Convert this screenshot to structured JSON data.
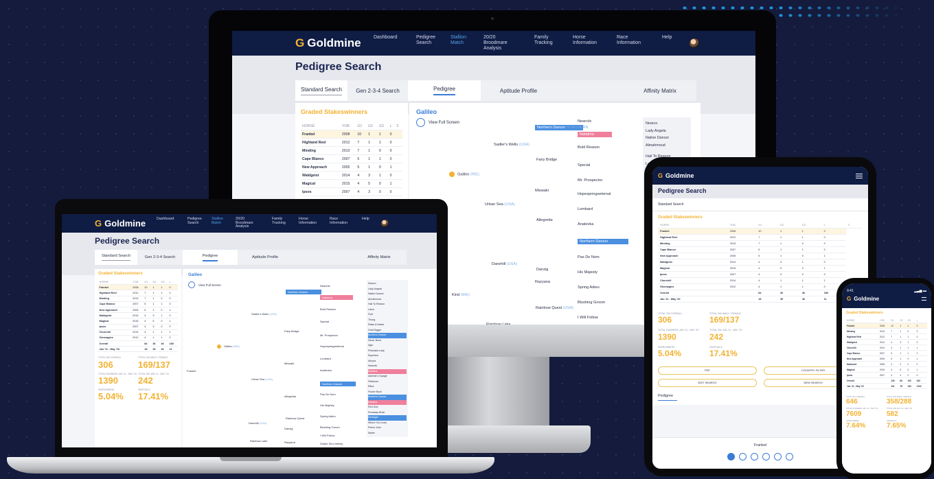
{
  "brand": {
    "logo_text": "Goldmine",
    "accent": "#f2b233",
    "nav_bg": "#0f1c44",
    "link_blue": "#3a7bd5"
  },
  "nav": {
    "items": [
      "Dashboard",
      "Pedigree Search",
      "Stallion Match",
      "20/20 Broodmare Analysis",
      "Family Tracking",
      "Horse Information",
      "Race Information",
      "Help"
    ],
    "active": "Stallion Match"
  },
  "page": {
    "title": "Pedigree Search"
  },
  "tabs": {
    "standard": "Standard Search",
    "gen": "Gen 2-3-4 Search",
    "pedigree": "Pedigree",
    "aptitude": "Aptitude Profile",
    "affinity": "Affinity Matrix"
  },
  "graded": {
    "title": "Graded Stakeswinners",
    "headers": [
      "HORSE",
      "YOB",
      "G1",
      "G2",
      "G3",
      "L",
      "Σ"
    ],
    "rows": [
      [
        "Frankel",
        "2008",
        "10",
        "1",
        "1",
        "0",
        ""
      ],
      [
        "Highland Reel",
        "2012",
        "7",
        "1",
        "1",
        "0",
        ""
      ],
      [
        "Minding",
        "2013",
        "7",
        "1",
        "0",
        "0",
        ""
      ],
      [
        "Cape Blanco",
        "2007",
        "5",
        "1",
        "1",
        "0",
        ""
      ],
      [
        "New Approach",
        "2005",
        "5",
        "1",
        "0",
        "1",
        ""
      ],
      [
        "Waldgeist",
        "2014",
        "4",
        "3",
        "1",
        "0",
        ""
      ],
      [
        "Magical",
        "2015",
        "4",
        "5",
        "0",
        "1",
        ""
      ],
      [
        "Ipsos",
        "2007",
        "4",
        "3",
        "0",
        "0",
        ""
      ],
      [
        "Churchill",
        "2014",
        "4",
        "1",
        "1",
        "1",
        ""
      ],
      [
        "Gleneagles",
        "2012",
        "4",
        "1",
        "1",
        "0",
        ""
      ]
    ],
    "laptop_rows": [
      [
        "Frankel",
        "2008",
        "10",
        "1",
        "1",
        "0"
      ],
      [
        "Highland Reel",
        "2012",
        "7",
        "1",
        "1",
        "0"
      ],
      [
        "Minding",
        "2013",
        "7",
        "1",
        "0",
        "0"
      ],
      [
        "Cape Blanco",
        "2007",
        "5",
        "1",
        "1",
        "0"
      ],
      [
        "New Approach",
        "2005",
        "5",
        "1",
        "0",
        "1"
      ],
      [
        "Waldgeist",
        "2014",
        "4",
        "3",
        "1",
        "0"
      ],
      [
        "Magical",
        "2015",
        "4",
        "5",
        "0",
        "1"
      ],
      [
        "Ipsos",
        "2007",
        "4",
        "3",
        "0",
        "0"
      ],
      [
        "Churchill",
        "2014",
        "4",
        "1",
        "1",
        "1"
      ],
      [
        "Gleneagles",
        "2012",
        "4",
        "1",
        "1",
        "0"
      ]
    ],
    "overall_label": "Overall",
    "overall": [
      "84",
      "36",
      "46",
      "180"
    ],
    "period_label": "Jan '11 - May '20",
    "period": [
      "18",
      "39",
      "46",
      "11"
    ]
  },
  "stats": {
    "winners_lbl": "TOTAL SW OVERALL",
    "winners_val": "306",
    "ratio_lbl": "TOTAL SW MALE / FEMALE",
    "ratio_val": "169/137",
    "runners_lbl": "TOTAL RUNNERS JAN '11 - MAY '20",
    "runners_val": "1390",
    "sw_lbl": "TOTAL SW JAN '11 - MAY '20",
    "sw_val": "242",
    "pct1_lbl": "SW/RUNNERS",
    "pct1_val": "5.04%",
    "pct2_lbl": "SW/FOALS",
    "pct2_val": "17.41%"
  },
  "pedigree": {
    "subject": "Galileo",
    "view_full": "View Full Screen",
    "sire": "Sadler's Wells",
    "sire_year": "(USA)",
    "dam": "Urban Sea",
    "dam_year": "(USA)",
    "fairy": "Fairy Bridge",
    "miswaki": "Miswaki",
    "allegretta": "Allegretta",
    "northern": "Northern Dancer",
    "northern_tag": "NORTHERN",
    "natalma": "Natalma",
    "bold": "Bold Reason",
    "special": "Special",
    "mrp": "Mr. Prospector",
    "hope": "Hopespringseternal",
    "lombard": "Lombard",
    "anatevka": "Anatevka",
    "nearctic": "Nearctic",
    "danzig": "Danzig",
    "danehill": "Danehill",
    "danehill_tag": "(USA)",
    "razyana": "Razyana",
    "pas": "Pas De Nom",
    "hismaj": "His Majesty",
    "spring": "Spring Adieu",
    "kind": "Kind",
    "kind_tag": "(IRE)",
    "rainbow_quest": "Rainbow Quest",
    "rainbow_tag": "(USA)",
    "rainbow_lake": "Rainbow Lake",
    "blushing": "Blushing Groom",
    "istill": "I Will Follow",
    "rightcol": [
      "Nearco",
      "Lady Angela",
      "Native Dancer",
      "Almahmoud",
      "Hail To Reason",
      "Lalun"
    ],
    "laptop_rightcol": [
      "Nearco",
      "Lady Angela",
      "Native Dancer",
      "Almahmoud",
      "Hail To Reason",
      "Lalun",
      "Forli",
      "Thong",
      "Raise A Native",
      "Gold Digger",
      "Northern Dancer",
      "Never Bend",
      "Aglo",
      "Pharsalia Lady",
      "Espresso",
      "Almyra",
      "Nearctic",
      "Natalma",
      "Admiral's Voyage",
      "Petitioner",
      "Ribot",
      "Flower Bowl",
      "Northern Dancer",
      "Natalma",
      "Red God",
      "Runaway Bride",
      "Herbager",
      "Where You Lead",
      "Prince John",
      "Mairie"
    ],
    "laptop_frankel": "Frankel",
    "laptop_nearctic2": "Nearctic",
    "laptop_nasrullah": "Shake Shot Infinity"
  },
  "tablet": {
    "standard": "Standard Search",
    "graded_title": "Graded Stakeswinners",
    "headers": [
      "HORSE",
      "YOB",
      "G1",
      "G2",
      "G3",
      "L",
      "Σ"
    ],
    "rows": [
      [
        "Frankel",
        "2008",
        "10",
        "1",
        "1",
        "0"
      ],
      [
        "Highland Reel",
        "2012",
        "7",
        "1",
        "1",
        "0"
      ],
      [
        "Minding",
        "2013",
        "7",
        "1",
        "0",
        "0"
      ],
      [
        "Cape Blanco",
        "2007",
        "5",
        "1",
        "1",
        "0"
      ],
      [
        "New Approach",
        "2005",
        "5",
        "1",
        "0",
        "1"
      ],
      [
        "Waldgeist",
        "2014",
        "4",
        "3",
        "1",
        "0"
      ],
      [
        "Magical",
        "2015",
        "4",
        "5",
        "0",
        "1"
      ],
      [
        "Ipsos",
        "2007",
        "4",
        "3",
        "0",
        "0"
      ],
      [
        "Churchill",
        "2014",
        "4",
        "1",
        "1",
        "1"
      ],
      [
        "Gleneagles",
        "2012",
        "4",
        "1",
        "1",
        "0"
      ]
    ],
    "overall": [
      "84",
      "36",
      "46",
      "180"
    ],
    "period": [
      "18",
      "39",
      "46",
      "11"
    ],
    "btn_pdf": "PDF",
    "btn_country": "COUNTRY FILTER",
    "btn_edit": "EDIT SEARCH",
    "btn_new": "NEW SEARCH",
    "pedigree_tab": "Pedigree",
    "footer_horse": "Frankel"
  },
  "phone": {
    "time": "9:41",
    "graded_title": "Graded Stakeswinners",
    "headers": [
      "HORSE",
      "YOB",
      "G1",
      "G2",
      "G3",
      "L"
    ],
    "rows": [
      [
        "Frankel",
        "2008",
        "10",
        "1",
        "1",
        "0"
      ],
      [
        "Minding",
        "2013",
        "7",
        "1",
        "0",
        "0"
      ],
      [
        "Highland Reel",
        "2012",
        "7",
        "1",
        "1",
        "0"
      ],
      [
        "Waldgeist",
        "2014",
        "4",
        "3",
        "1",
        "0"
      ],
      [
        "Churchill",
        "2014",
        "4",
        "1",
        "1",
        "1"
      ],
      [
        "Cape Blanco",
        "2007",
        "5",
        "1",
        "1",
        "0"
      ],
      [
        "New Approach",
        "2005",
        "5",
        "1",
        "0",
        "1"
      ],
      [
        "Nathaniel",
        "2008",
        "4",
        "2",
        "0",
        "0"
      ],
      [
        "Magical",
        "2015",
        "4",
        "5",
        "0",
        "1"
      ],
      [
        "Ipsos",
        "2007",
        "4",
        "3",
        "0",
        "0"
      ]
    ],
    "overall": [
      "126",
      "66",
      "100",
      "392"
    ],
    "period": [
      "101",
      "78",
      "160",
      "2102"
    ],
    "s1": "646",
    "s2": "358/288",
    "s3": "7609",
    "s4": "582",
    "s5": "7.64%",
    "s6": "7.65%"
  }
}
